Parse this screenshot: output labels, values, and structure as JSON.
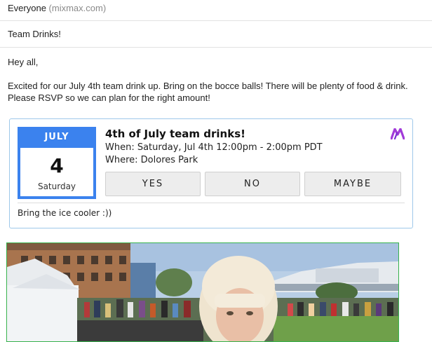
{
  "compose": {
    "to": {
      "recipient": "Everyone",
      "domain": "(mixmax.com)"
    },
    "subject": "Team Drinks!",
    "body": {
      "greeting": "Hey all,",
      "line1": "Excited for our July 4th team drink up. Bring on the bocce balls! There will be plenty of food & drink.",
      "line2": "Please RSVP so we can plan for the right amount!"
    }
  },
  "event_card": {
    "calendar": {
      "month": "JULY",
      "day": "4",
      "weekday": "Saturday"
    },
    "title": "4th of July team drinks!",
    "when": "When: Saturday, Jul 4th 12:00pm - 2:00pm PDT",
    "where": "Where: Dolores Park",
    "buttons": {
      "yes": "YES",
      "no": "NO",
      "maybe": "MAYBE"
    },
    "note": "Bring the ice cooler :))",
    "logo_icon": "mixmax-logo-icon",
    "colors": {
      "accent": "#3b82ee",
      "card_border": "#9ec8ea",
      "logo": "#a13bd8"
    }
  },
  "photo": {
    "icon": "festival-photo"
  }
}
